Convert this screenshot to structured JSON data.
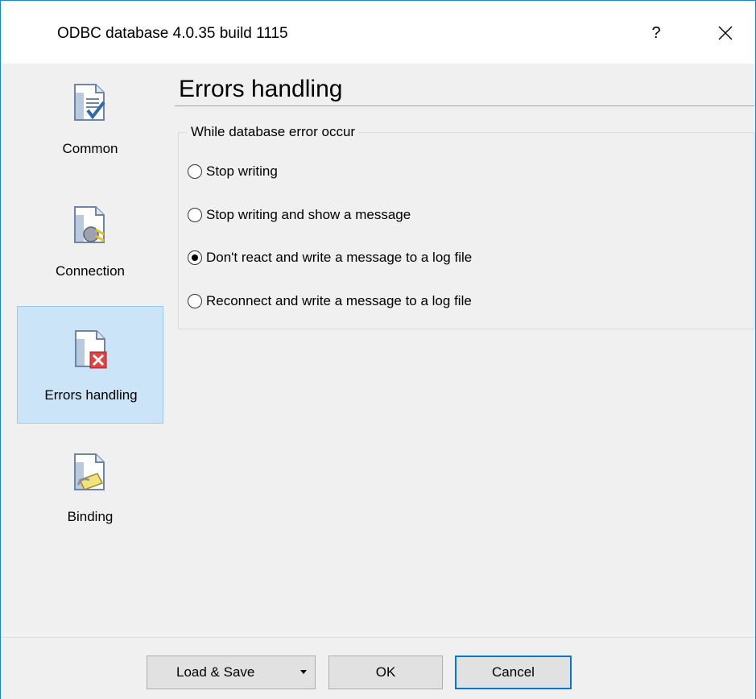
{
  "window": {
    "title": "ODBC database 4.0.35 build 1115",
    "help_label": "?",
    "close_icon": "close-icon"
  },
  "sidebar": {
    "items": [
      {
        "label": "Common",
        "icon": "document-check-icon",
        "selected": false
      },
      {
        "label": "Connection",
        "icon": "document-plug-icon",
        "selected": false
      },
      {
        "label": "Errors handling",
        "icon": "document-error-icon",
        "selected": true
      },
      {
        "label": "Binding",
        "icon": "document-link-icon",
        "selected": false
      }
    ]
  },
  "main": {
    "title": "Errors handling",
    "group_label": "While database error occur",
    "options": [
      {
        "label": "Stop writing",
        "checked": false
      },
      {
        "label": "Stop writing and show a message",
        "checked": false
      },
      {
        "label": "Don't react and write a message to a log file",
        "checked": true
      },
      {
        "label": "Reconnect and write a message to a log file",
        "checked": false
      }
    ]
  },
  "footer": {
    "load_save_label": "Load & Save",
    "ok_label": "OK",
    "cancel_label": "Cancel"
  },
  "colors": {
    "accent": "#0078d7",
    "selection_bg": "#cce4f7",
    "selection_border": "#99c9ef",
    "error_red": "#e04343"
  }
}
